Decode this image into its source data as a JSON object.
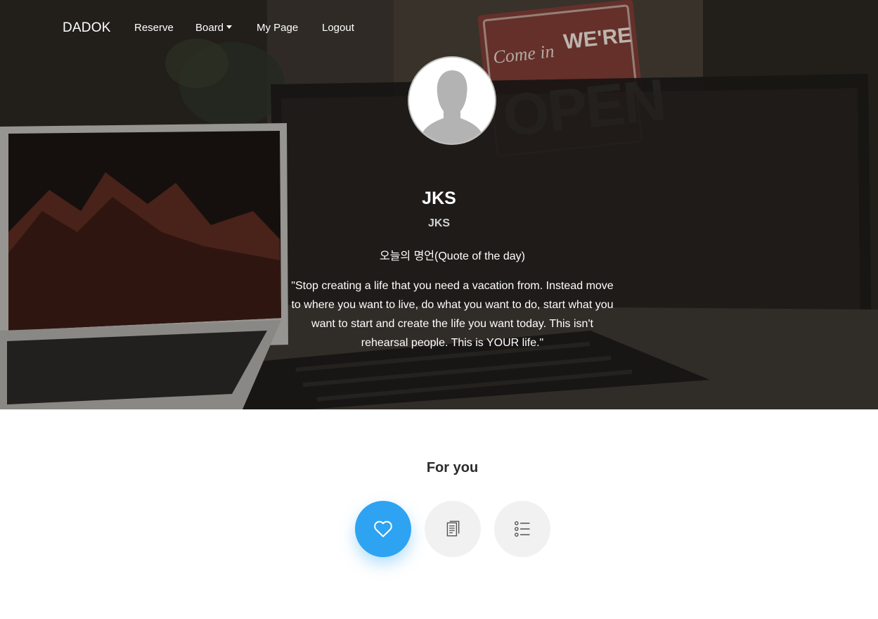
{
  "nav": {
    "brand": "DADOK",
    "links": [
      "Reserve",
      "Board",
      "My Page",
      "Logout"
    ],
    "board_has_dropdown": true
  },
  "hero": {
    "background": "laptop-desk-open-sign-photo",
    "sign_text": "Come in WE'RE OPEN",
    "avatar_icon": "default-user-silhouette-icon"
  },
  "profile": {
    "name": "JKS",
    "subtitle": "JKS",
    "quote_heading": "오늘의 명언(Quote of the day)",
    "quote": "\"Stop creating a life that you need a vacation from. Instead move to where you want to live, do what you want to do, start what you want to start and create the life you want today. This isn't rehearsal people. This is YOUR life.\""
  },
  "for_you": {
    "title": "For you",
    "buttons": [
      {
        "name": "heart-icon",
        "active": true
      },
      {
        "name": "document-icon",
        "active": false
      },
      {
        "name": "list-icon",
        "active": false
      }
    ]
  },
  "colors": {
    "accent": "#2ea3f2",
    "inactive_button": "#f1f1f1",
    "heading": "#2b2b2b"
  }
}
